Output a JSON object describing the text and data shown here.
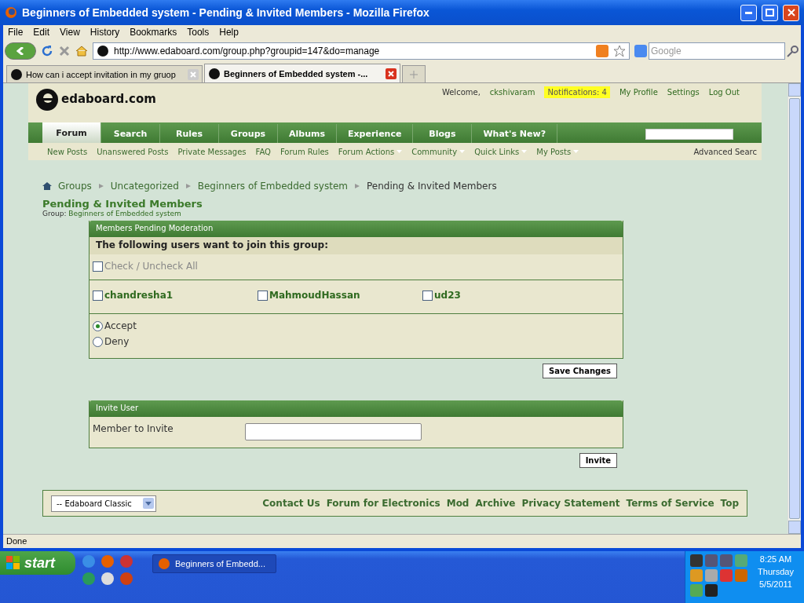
{
  "window": {
    "title": "Beginners of Embedded system - Pending & Invited Members - Mozilla Firefox"
  },
  "menu": [
    "File",
    "Edit",
    "View",
    "History",
    "Bookmarks",
    "Tools",
    "Help"
  ],
  "toolbar": {
    "url": "http://www.edaboard.com/group.php?groupid=147&do=manage",
    "search_placeholder": "Google"
  },
  "tabs": [
    {
      "label": "How can i accept invitation in my gruop",
      "selected": false
    },
    {
      "label": "Beginners of Embedded system -...",
      "selected": true
    }
  ],
  "site": {
    "logo": "edaboard.com",
    "welcome": "Welcome,",
    "username": "ckshivaram",
    "notifications": "Notifications: 4",
    "links": [
      "My Profile",
      "Settings",
      "Log Out"
    ],
    "nav": [
      {
        "label": "Forum",
        "selected": true
      },
      {
        "label": "Search",
        "selected": false
      },
      {
        "label": "Rules",
        "selected": false
      },
      {
        "label": "Groups",
        "selected": false
      },
      {
        "label": "Albums",
        "selected": false
      },
      {
        "label": "Experience",
        "selected": false
      },
      {
        "label": "Blogs",
        "selected": false
      },
      {
        "label": "What's New?",
        "selected": false
      }
    ],
    "subnav": [
      {
        "label": "New Posts",
        "dropdown": false
      },
      {
        "label": "Unanswered Posts",
        "dropdown": false
      },
      {
        "label": "Private Messages",
        "dropdown": false
      },
      {
        "label": "FAQ",
        "dropdown": false
      },
      {
        "label": "Forum Rules",
        "dropdown": false
      },
      {
        "label": "Forum Actions",
        "dropdown": true
      },
      {
        "label": "Community",
        "dropdown": true
      },
      {
        "label": "Quick Links",
        "dropdown": true
      },
      {
        "label": "My Posts",
        "dropdown": true
      }
    ],
    "advanced_search": "Advanced Searc"
  },
  "breadcrumb": [
    "Groups",
    "Uncategorized",
    "Beginners of Embedded system",
    "Pending & Invited Members"
  ],
  "page_title": "Pending & Invited Members",
  "group_label": "Group:",
  "group_name": "Beginners of Embedded system",
  "pending": {
    "title": "Members Pending Moderation",
    "prompt": "The following users want to join this group:",
    "check_all": {
      "label": "Check / Uncheck All",
      "checked": false
    },
    "members": [
      {
        "name": "chandresha1",
        "checked": false
      },
      {
        "name": "MahmoudHassan",
        "checked": false
      },
      {
        "name": "ud23",
        "checked": false
      }
    ],
    "actions": [
      {
        "label": "Accept",
        "selected": true
      },
      {
        "label": "Deny",
        "selected": false
      }
    ],
    "button": "Save Changes"
  },
  "invite": {
    "title": "Invite User",
    "field_label": "Member to Invite",
    "button": "Invite"
  },
  "footer": {
    "style": "-- Edaboard Classic",
    "links": [
      "Contact Us",
      "Forum for Electronics",
      "Mod",
      "Archive",
      "Privacy Statement",
      "Terms of Service",
      "Top"
    ]
  },
  "status": "Done",
  "taskbar": {
    "start": "start",
    "task": "Beginners of Embedd...",
    "clock": [
      "8:25 AM",
      "Thursday",
      "5/5/2011"
    ]
  }
}
